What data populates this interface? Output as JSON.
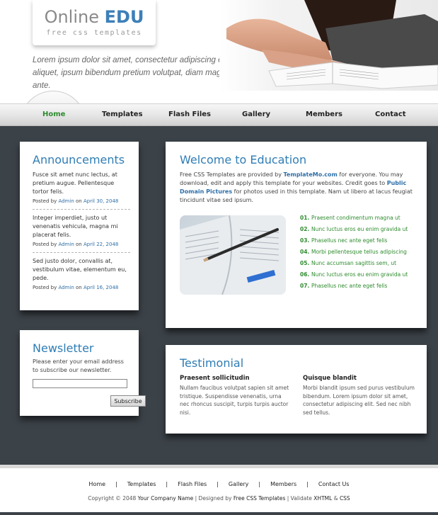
{
  "header": {
    "logo_main": "Online",
    "logo_accent": "EDU",
    "logo_sub": "free css templates",
    "tagline": "Lorem ipsum dolor sit amet, consectetur adipiscing elit. Nulla aliquet, ipsum bibendum pretium volutpat, diam magna facilisis ante."
  },
  "nav": {
    "items": [
      {
        "label": "Home"
      },
      {
        "label": "Templates"
      },
      {
        "label": "Flash Files"
      },
      {
        "label": "Gallery"
      },
      {
        "label": "Members"
      },
      {
        "label": "Contact"
      }
    ]
  },
  "announcements": {
    "title": "Announcements",
    "items": [
      {
        "text": "Fusce sit amet nunc lectus, at pretium augue. Pellentesque tortor felis.",
        "posted_by": "Posted by",
        "author": "Admin",
        "on": "on",
        "date": "April 30, 2048"
      },
      {
        "text": "Integer imperdiet, justo ut venenatis vehicula, magna mi placerat felis.",
        "posted_by": "Posted by",
        "author": "Admin",
        "on": "on",
        "date": "April 22, 2048"
      },
      {
        "text": "Sed justo dolor, convallis at, vestibulum vitae, elementum eu, pede.",
        "posted_by": "Posted by",
        "author": "Admin",
        "on": "on",
        "date": "April 16, 2048"
      }
    ]
  },
  "newsletter": {
    "title": "Newsletter",
    "text": "Please enter your email address to subscribe our newsletter.",
    "input_value": "",
    "button": "Subscribe"
  },
  "welcome": {
    "title": "Welcome to Education",
    "text_1": "Free CSS Templates are provided by ",
    "link_1": "TemplateMo.com",
    "text_2": " for everyone. You may download, edit and apply this template for your websites. Credit goes to ",
    "link_2": "Public Domain Pictures",
    "text_3": " for photos used in this template. Nam ut libero at lacus feugiat tincidunt vitae sed ipsum.",
    "list": [
      {
        "num": "01.",
        "text": "Praesent condimentum magna ut"
      },
      {
        "num": "02.",
        "text": "Nunc luctus eros eu enim gravida ut"
      },
      {
        "num": "03.",
        "text": "Phasellus nec ante eget felis"
      },
      {
        "num": "04.",
        "text": "Morbi pellentesque tellus adipiscing"
      },
      {
        "num": "05.",
        "text": "Nunc accumsan sagittis sem, ut"
      },
      {
        "num": "06.",
        "text": "Nunc luctus eros eu enim gravida ut"
      },
      {
        "num": "07.",
        "text": "Phasellus nec ante eget felis"
      }
    ]
  },
  "testimonial": {
    "title": "Testimonial",
    "items": [
      {
        "heading": "Praesent sollicitudin",
        "body": "Nullam faucibus volutpat sapien sit amet tristique. Suspendisse venenatis, urna nec rhoncus suscipit, turpis turpis auctor nisi."
      },
      {
        "heading": "Quisque blandit",
        "body": "Morbi blandit ipsum sed purus vestibulum bibendum. Lorem ipsum dolor sit amet, consectetur adipiscing elit. Sed nec nibh sed tellus."
      }
    ]
  },
  "footer": {
    "nav": [
      "Home",
      "Templates",
      "Flash Files",
      "Gallery",
      "Members",
      "Contact Us"
    ],
    "sep": "|",
    "copy_1": "Copyright © 2048 ",
    "company": "Your Company Name",
    "copy_2": " | Designed by ",
    "designer": "Free CSS Templates",
    "copy_3": " | Validate ",
    "xhtml": "XHTML",
    "amp": " & ",
    "css": "CSS"
  },
  "colors": {
    "accent_blue": "#2f7db5",
    "active_green": "#2e8b2e",
    "main_bg": "#3b4248"
  },
  "icons": {
    "hero": "student-reading-photo",
    "welcome_image": "book-and-pencil-photo"
  }
}
